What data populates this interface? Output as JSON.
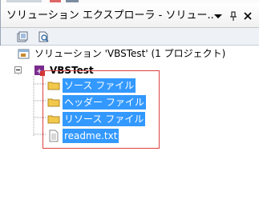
{
  "window": {
    "title": "ソリューション エクスプローラ - ソリュー...",
    "dropdown_glyph": "▼",
    "pin_glyph": "📌",
    "close_glyph": "✕"
  },
  "toolbar": {
    "buttons": [
      "properties-icon",
      "show-all-files-icon"
    ]
  },
  "tree": {
    "solution": {
      "label": "ソリューション 'VBSTest' (1 プロジェクト)",
      "icon": "solution-icon"
    },
    "project": {
      "label": "VBSTest",
      "icon": "project-icon",
      "expand_glyph": "−"
    },
    "items": [
      {
        "label": "ソース ファイル",
        "icon": "folder-icon",
        "selected": true
      },
      {
        "label": "ヘッダー ファイル",
        "icon": "folder-icon",
        "selected": true
      },
      {
        "label": "リソース ファイル",
        "icon": "folder-icon",
        "selected": true
      },
      {
        "label": "readme.txt",
        "icon": "text-file-icon",
        "selected": true
      }
    ]
  },
  "colors": {
    "selection": "#3399ff",
    "highlight_box": "#e04040",
    "folder": "#f2c84b"
  }
}
